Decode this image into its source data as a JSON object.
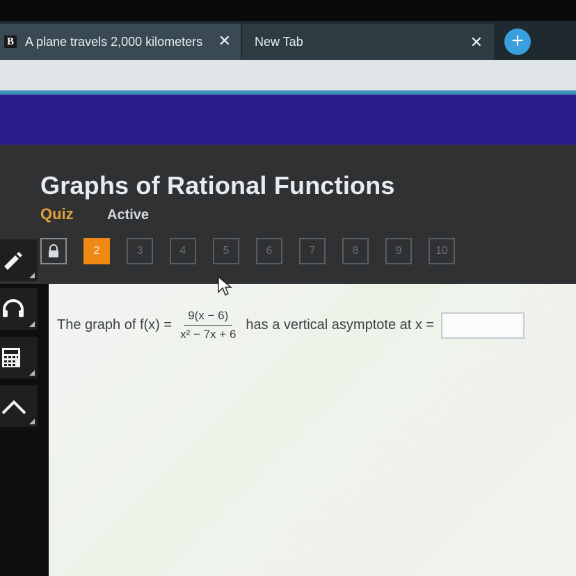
{
  "browser": {
    "tabs": [
      {
        "favicon": "B",
        "title": "A plane travels 2,000 kilometers",
        "close": "✕"
      },
      {
        "title": "New Tab",
        "close": "✕"
      }
    ],
    "new_tab_symbol": "+"
  },
  "header": {
    "title": "Graphs of Rational Functions",
    "type_label": "Quiz",
    "status_label": "Active"
  },
  "question_nav": {
    "current": "2",
    "items": [
      "3",
      "4",
      "5",
      "6",
      "7",
      "8",
      "9",
      "10"
    ],
    "lock_icon": "lock-icon"
  },
  "toolbar": {
    "icons": [
      "pencil-icon",
      "headphones-icon",
      "calculator-icon",
      "collapse-up-icon"
    ]
  },
  "question": {
    "prefix": "The graph of f(x) =",
    "numerator": "9(x − 6)",
    "denominator": "x² − 7x + 6",
    "suffix": "has a vertical asymptote at x ="
  },
  "colors": {
    "accent_orange": "#f08a14",
    "quiz_label": "#e3a13e",
    "banner": "#2b1d8a",
    "header_bg": "#2f3133"
  }
}
